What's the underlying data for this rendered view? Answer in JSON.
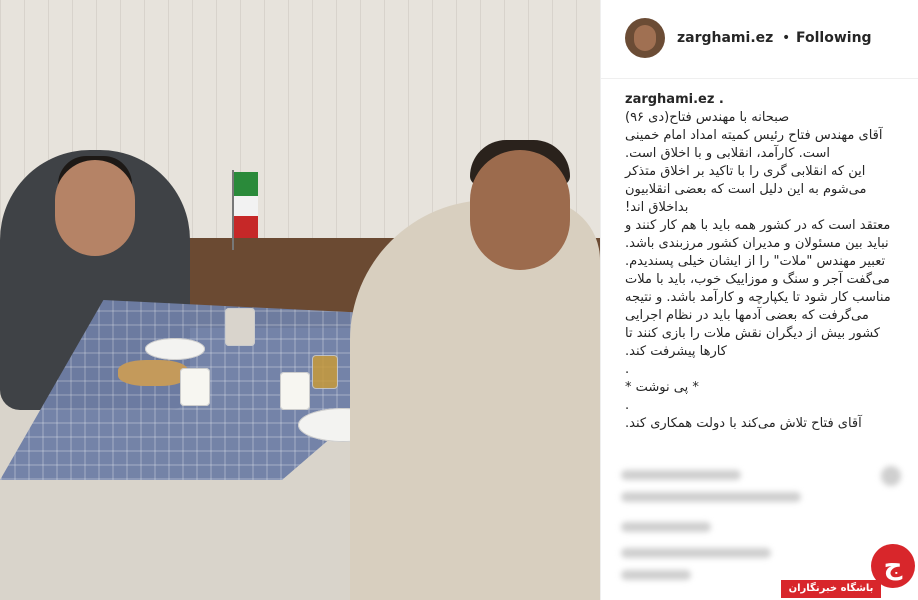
{
  "post": {
    "username": "zarghami.ez",
    "separator": "•",
    "follow_status": "Following",
    "caption_username": "zarghami.ez .",
    "caption_text": "صبحانه با مهندس فتاح(دی ۹۶)\nآقای مهندس فتاح رئیس کمیته امداد امام خمینی است. کارآمد، انقلابی و با اخلاق است.\nاین که انقلابی گری را با تاکید بر اخلاق متذکر می‌شوم به این دلیل است که بعضی انقلابیون بداخلاق اند!\nمعتقد است که در کشور همه باید با هم کار کنند و نباید بین مسئولان و مدیران کشور مرزبندی باشد.\nتعبیر مهندس \"ملات\" را از ایشان خیلی پسندیدم. می‌گفت آجر و سنگ و موزاییک خوب، باید با ملات مناسب کار شود تا یکپارچه و کارآمد باشد. و نتیجه می‌گرفت که بعضی آدمها باید در نظام اجرایی کشور بیش از دیگران نقش ملات را بازی کنند تا کارها پیشرفت کند.\n.\n* پی نوشت *\n.\nآقای فتاح تلاش می‌کند با دولت همکاری کند."
  },
  "icons": {
    "avatar": "profile-photo",
    "watermark": "news-agency-logo"
  },
  "watermark": {
    "label": "باشگاه خبرنگاران",
    "glyph": "ج"
  },
  "colors": {
    "watermark_red": "#d8262b",
    "text": "#262626"
  }
}
